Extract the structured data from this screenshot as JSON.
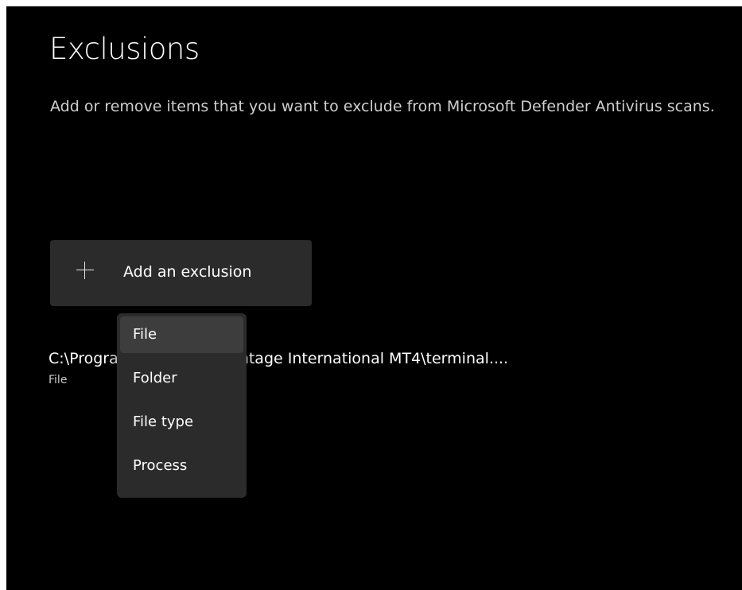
{
  "page": {
    "title": "Exclusions",
    "description": "Add or remove items that you want to exclude from Microsoft Defender Antivirus scans."
  },
  "add_button": {
    "label": "Add an exclusion",
    "icon": "plus-icon"
  },
  "exclusions": [
    {
      "path": "C:\\Program Files (x86)\\Vantage International MT4\\terminal....",
      "type": "File"
    }
  ],
  "menu": {
    "items": [
      {
        "label": "File",
        "highlighted": true
      },
      {
        "label": "Folder",
        "highlighted": false
      },
      {
        "label": "File type",
        "highlighted": false
      },
      {
        "label": "Process",
        "highlighted": false
      }
    ]
  },
  "colors": {
    "background": "#000000",
    "button": "#2b2b2b",
    "menu": "#2b2b2b",
    "menu_highlight": "#3d3d3d",
    "text": "#ffffff"
  }
}
